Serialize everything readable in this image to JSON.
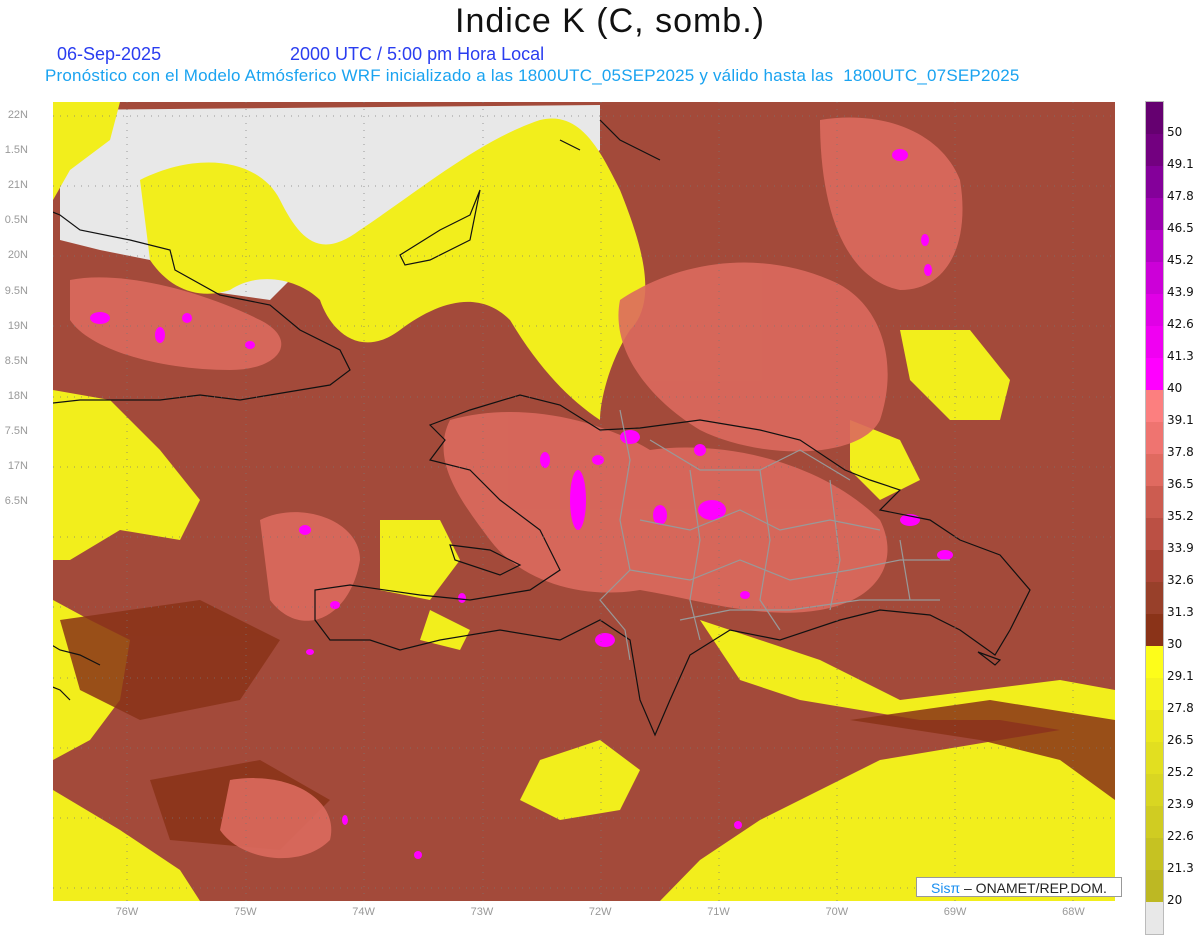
{
  "header": {
    "title": "Indice K (C, somb.)",
    "date": "06-Sep-2025",
    "time": "2000 UTC / 5:00 pm Hora Local",
    "info": "Pronóstico con el Modelo Atmósferico WRF inicializado a las 1800UTC_05SEP2025 y válido hasta las  1800UTC_07SEP2025"
  },
  "axes": {
    "lat_labels": [
      "22N",
      "1.5N",
      "21N",
      "0.5N",
      "20N",
      "9.5N",
      "19N",
      "8.5N",
      "18N",
      "7.5N",
      "17N",
      "6.5N"
    ],
    "lat_values": [
      22,
      21.5,
      21,
      20.5,
      20,
      19.5,
      19,
      18.5,
      18,
      17.5,
      17,
      16.5
    ],
    "lon_labels": [
      "76W",
      "75W",
      "74W",
      "73W",
      "72W",
      "71W",
      "70W",
      "69W",
      "68W"
    ],
    "lon_values": [
      -76,
      -75,
      -74,
      -73,
      -72,
      -71,
      -70,
      -69,
      -68
    ]
  },
  "colorbar": {
    "labels": [
      "50",
      "49.1",
      "47.8",
      "46.5",
      "45.2",
      "43.9",
      "42.6",
      "41.3",
      "40",
      "39.1",
      "37.8",
      "36.5",
      "35.2",
      "33.9",
      "32.6",
      "31.3",
      "30",
      "29.1",
      "27.8",
      "26.5",
      "25.2",
      "23.9",
      "22.6",
      "21.3",
      "20"
    ],
    "colors": [
      "#650070",
      "#730080",
      "#84009a",
      "#9a00ae",
      "#b400c6",
      "#cc00d8",
      "#e000e6",
      "#f000f2",
      "#ff00ff",
      "#fc7f7f",
      "#ef7470",
      "#e06a60",
      "#cc5c50",
      "#bb5044",
      "#aa4536",
      "#98402a",
      "#8a3318",
      "#fdfd1a",
      "#f5f31e",
      "#ebe81e",
      "#e2df20",
      "#d9d622",
      "#d0cc22",
      "#c6c222",
      "#bdb823",
      "#e8e8e8"
    ]
  },
  "credit": {
    "brand": "Sisπ",
    "text": " –  ONAMET/REP.DOM."
  }
}
